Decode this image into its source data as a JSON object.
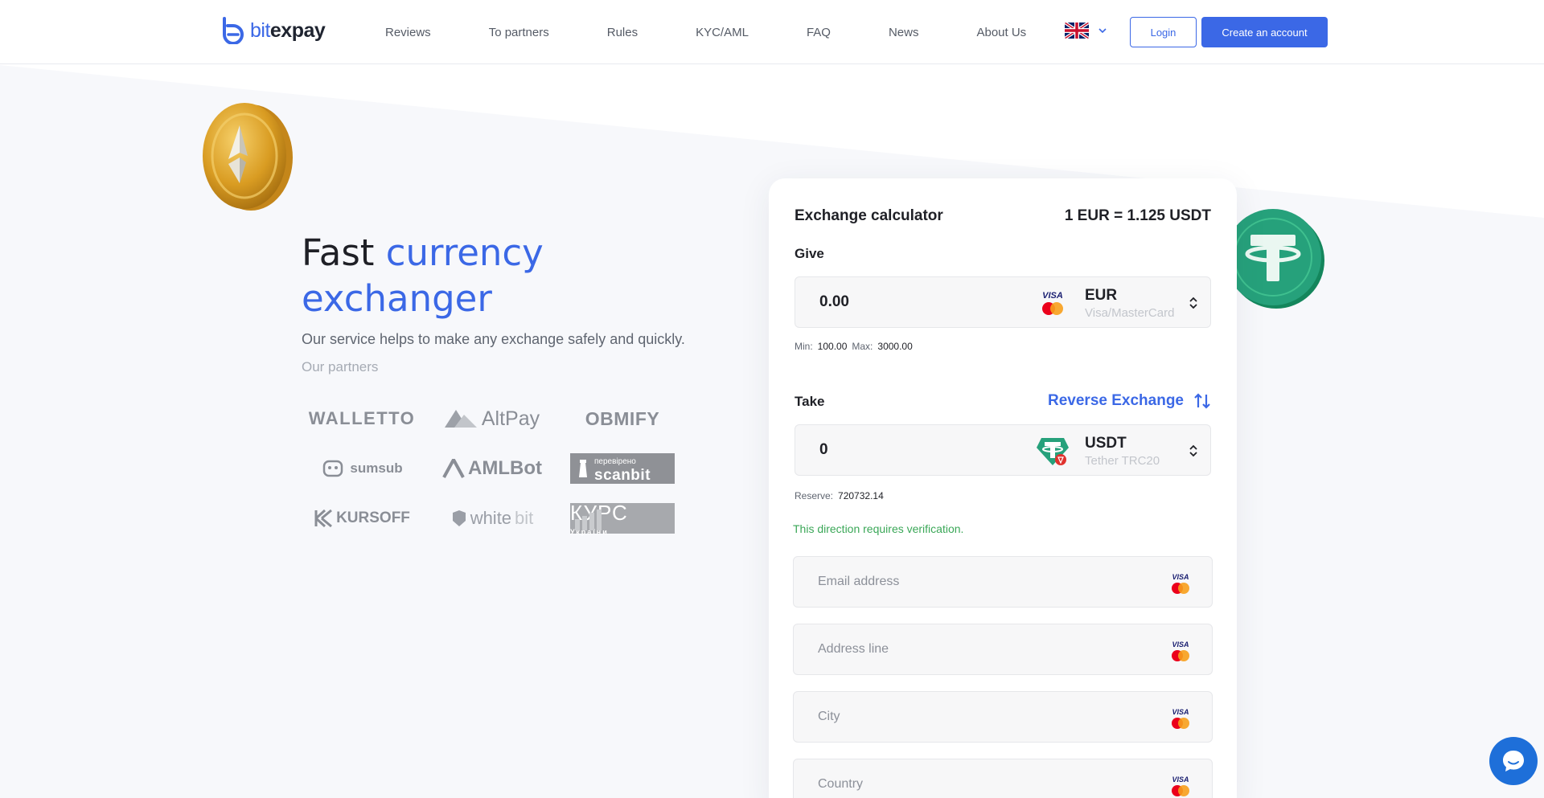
{
  "header": {
    "brand": "bitexpay",
    "brand_prefix": "bit",
    "brand_suffix": "expay",
    "nav": [
      "Reviews",
      "To partners",
      "Rules",
      "KYC/AML",
      "FAQ",
      "News",
      "About Us"
    ],
    "language_icon": "uk-flag-icon",
    "login_label": "Login",
    "create_label": "Create an account",
    "accent_color": "#3b68e6"
  },
  "hero": {
    "title_plain": "Fast ",
    "title_accent_1": "currency",
    "title_accent_2": "exchanger",
    "subtitle": "Our service helps to make any exchange safely and quickly.",
    "partners_label": "Our partners",
    "partners": {
      "walletto": "WALLETTO",
      "altpay": "AltPay",
      "obmify": "OBMIFY",
      "sumsub": "sumsub",
      "amlbot": "AMLBot",
      "scanbit_top": "перевірено",
      "scanbit": "scanbit",
      "kursoff": "KURSOFF",
      "whitebit_a": "white",
      "whitebit_b": "bit",
      "kurs": "КУРС",
      "kurs_sub": "України"
    }
  },
  "calculator": {
    "title": "Exchange calculator",
    "rate": "1 EUR = 1.125 USDT",
    "give_label": "Give",
    "give_amount": "0.00",
    "give_currency": "EUR",
    "give_method": "Visa/MasterCard",
    "min_label": "Min:",
    "min_value": "100.00",
    "max_label": "Max:",
    "max_value": "3000.00",
    "take_label": "Take",
    "reverse_label": "Reverse Exchange",
    "take_amount": "0",
    "take_currency": "USDT",
    "take_method": "Tether TRC20",
    "reserve_label": "Reserve:",
    "reserve_value": "720732.14",
    "verification_note": "This direction requires verification.",
    "fields": {
      "email_placeholder": "Email address",
      "address_placeholder": "Address line",
      "city_placeholder": "City",
      "country_placeholder": "Country"
    },
    "success_color": "#3aa757"
  },
  "chat": {
    "icon": "chat-bubble-icon"
  }
}
